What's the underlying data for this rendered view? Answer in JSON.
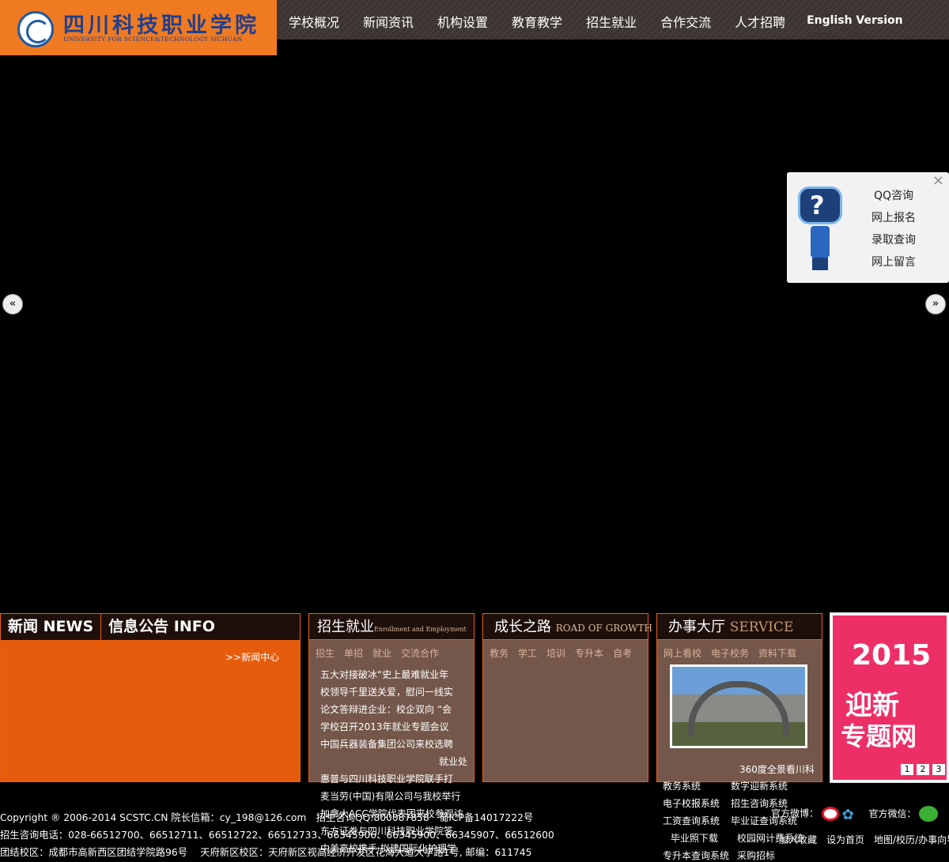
{
  "header": {
    "logo_cn": "四川科技职业学院",
    "logo_en": "UNIVERSITY FOR SCIENCE&TECHNOLOGY SICHUAN",
    "nav": [
      "学校概况",
      "新闻资讯",
      "机构设置",
      "教育教学",
      "招生就业",
      "合作交流",
      "人才招聘"
    ],
    "english": "English Version"
  },
  "slider": {
    "prev": "«",
    "next": "»"
  },
  "consult": {
    "close": "×",
    "items": [
      "QQ咨询",
      "网上报名",
      "录取查询",
      "网上留言"
    ],
    "robot_mark": "?"
  },
  "news": {
    "tab1": "新闻 NEWS",
    "tab2": "信息公告 INFO",
    "more": ">>新闻中心"
  },
  "employ": {
    "title": "招生就业",
    "subtitle": "Enrollment and Employment",
    "tabs": [
      "招生",
      "单招",
      "就业",
      "交流合作"
    ],
    "items": [
      "五大对接破冰“史上最难就业年",
      "校领导千里送关爱，慰问一线实",
      "论文答辩进企业：校企双向 “会",
      "学校召开2013年就业专题会议",
      "中国兵器装备集团公司来校选聘",
      "就业处",
      "惠普与四川科技职业学院联手打",
      "麦当劳(中国)有限公司与我校举行",
      "加拿大ACC学院代表团来校参观访",
      "东方证券与四川科技职业学院签",
      "中美高校携手 拟建国际化护理学"
    ]
  },
  "growth": {
    "title": "成长之路",
    "subtitle": "ROAD OF GROWTH",
    "tabs": [
      "教务",
      "学工",
      "培训",
      "专升本",
      "自考"
    ]
  },
  "service": {
    "title": "办事大厅",
    "subtitle": "SERVICE",
    "tabs": [
      "网上看校",
      "电子校务",
      "资料下载"
    ],
    "caption": "360度全景看川科"
  },
  "promo": {
    "year": "2015",
    "line1": "迎新",
    "line2": "专题网",
    "pages": [
      "1",
      "2",
      "3"
    ]
  },
  "systems": [
    [
      "教务系统",
      "数字迎新系统"
    ],
    [
      "电子校报系统",
      "招生咨询系统"
    ],
    [
      "工资查询系统",
      "毕业证查询系统"
    ],
    [
      "毕业照下载",
      "校园网计费系统"
    ],
    [
      "专升本查询系统",
      "采购招标"
    ]
  ],
  "footer": {
    "copyright": "Copyright ® 2006-2014 SCSTC.CN 院长信箱：cy_198@126.com　招生咨询QQ:800087858　蜀ICP备14017222号",
    "phone": "招生咨询电话：028-66512700、66512711、66512722、66512733、66345906、66345900、66345907、66512600",
    "address": "团结校区：成都市高新西区团结学院路96号　 天府新区校区：天府新区视高经济开发区花海大道大学路1号, 邮编：611745",
    "weibo_label": "官方微博：",
    "wechat_label": "官方微信：",
    "links": "加入收藏　设为首页　地图/校历/办事向导"
  }
}
